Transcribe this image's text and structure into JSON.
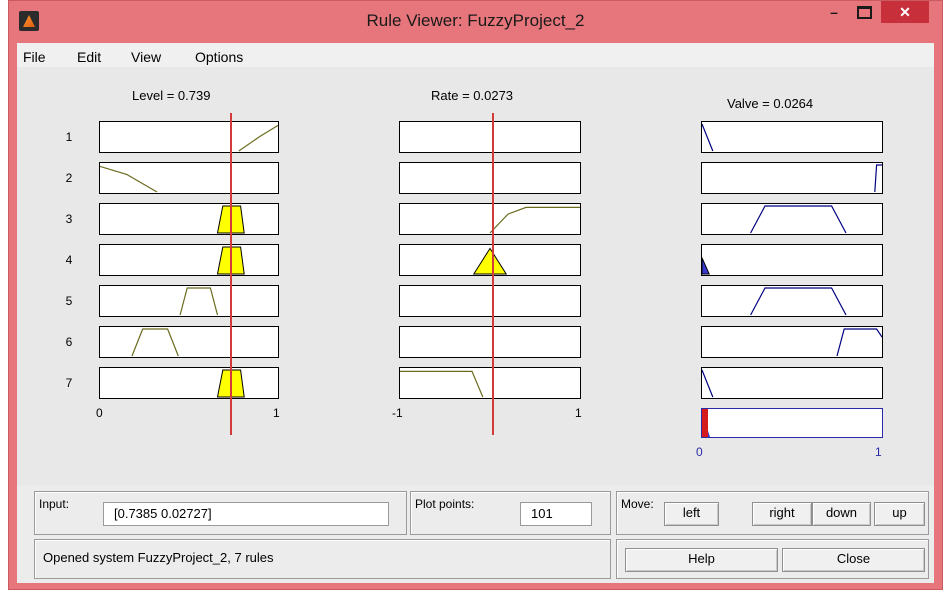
{
  "window": {
    "title": "Rule Viewer: FuzzyProject_2",
    "minimize": "–",
    "close": "✕"
  },
  "menu": [
    "File",
    "Edit",
    "View",
    "Options"
  ],
  "columns": {
    "level": {
      "label": "Level = 0.739",
      "tick_min": "0",
      "tick_max": "1"
    },
    "rate": {
      "label": "Rate = 0.0273",
      "tick_min": "-1",
      "tick_max": "1"
    },
    "valve": {
      "label": "Valve = 0.0264",
      "tick_min": "0",
      "tick_max": "1"
    }
  },
  "rules": [
    "1",
    "2",
    "3",
    "4",
    "5",
    "6",
    "7"
  ],
  "colors": {
    "mf_line": "#6b6b1f",
    "fill_yellow": "#ffff00",
    "fill_blue": "#3a3ad0",
    "crisp_line": "#d33a3a",
    "agg_fill_red": "#d41a1a"
  },
  "bottom": {
    "input_label": "Input:",
    "input_value": "[0.7385 0.02727]",
    "plot_points_label": "Plot points:",
    "plot_points_value": "101",
    "move_label": "Move:",
    "move_buttons": {
      "left": "left",
      "right": "right",
      "down": "down",
      "up": "up"
    },
    "status": "Opened system FuzzyProject_2, 7 rules",
    "help": "Help",
    "close": "Close"
  }
}
